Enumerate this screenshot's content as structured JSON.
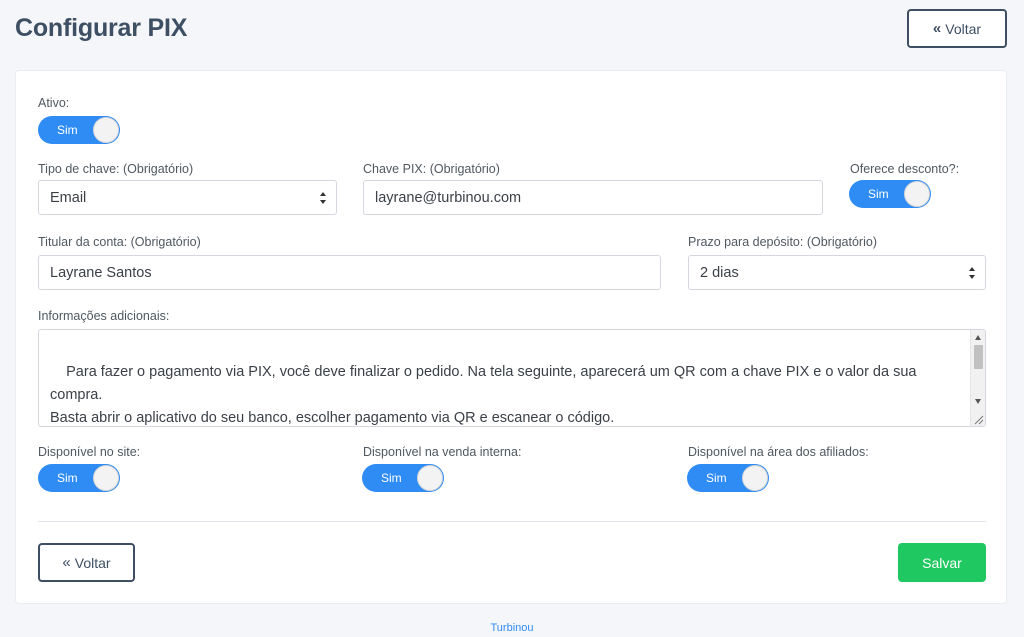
{
  "header": {
    "title": "Configurar PIX",
    "back_label": "Voltar"
  },
  "form": {
    "ativo": {
      "label": "Ativo:",
      "toggle": "Sim"
    },
    "tipo_chave": {
      "label": "Tipo de chave: (Obrigatório)",
      "value": "Email"
    },
    "chave_pix": {
      "label": "Chave PIX: (Obrigatório)",
      "value": "layrane@turbinou.com"
    },
    "desconto": {
      "label": "Oferece desconto?:",
      "toggle": "Sim"
    },
    "titular": {
      "label": "Titular da conta: (Obrigatório)",
      "value": "Layrane Santos"
    },
    "prazo": {
      "label": "Prazo para depósito: (Obrigatório)",
      "value": "2 dias"
    },
    "info": {
      "label": "Informações adicionais:",
      "value": "Para fazer o pagamento via PIX, você deve finalizar o pedido. Na tela seguinte, aparecerá um QR com a chave PIX e o valor da sua compra.\nBasta abrir o aplicativo do seu banco, escolher pagamento via QR e escanear o código.\n\nCaso você esteja usando o celular para fazer o pedido, há a opção de copiar o código. Dessa forma, basta selecionar, no app do seu"
    },
    "site": {
      "label": "Disponível no site:",
      "toggle": "Sim"
    },
    "venda_interna": {
      "label": "Disponível na venda interna:",
      "toggle": "Sim"
    },
    "afiliados": {
      "label": "Disponível na área dos afiliados:",
      "toggle": "Sim"
    }
  },
  "actions": {
    "back_label": "Voltar",
    "save_label": "Salvar"
  },
  "footer": {
    "link": "Turbinou"
  },
  "colors": {
    "accent": "#2f8cf5",
    "save": "#1fc860",
    "title": "#3e4f63"
  }
}
